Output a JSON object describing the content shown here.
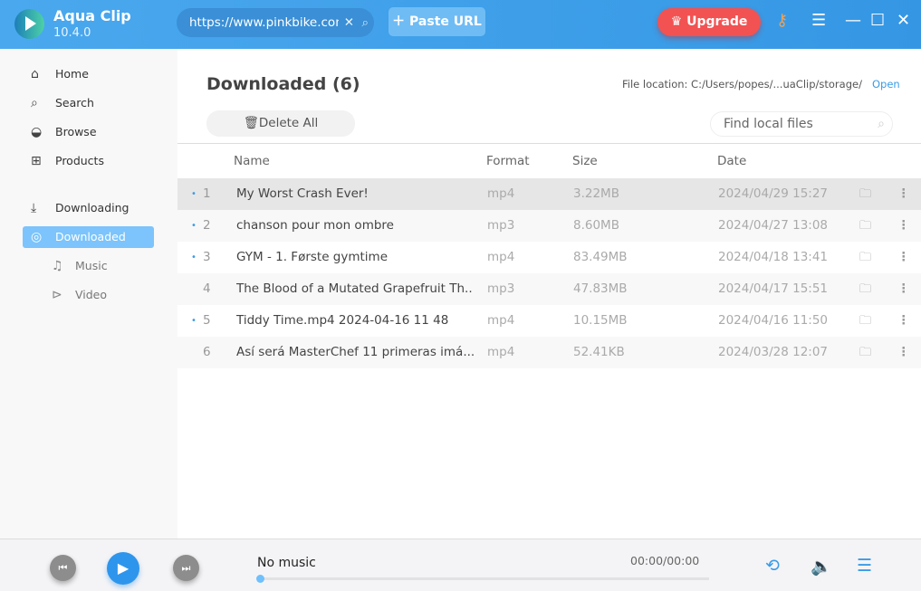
{
  "app": {
    "name": "Aqua Clip",
    "version": "10.4.0"
  },
  "header": {
    "url_value": "https://www.pinkbike.com",
    "paste_label": "Paste URL",
    "upgrade_label": "Upgrade"
  },
  "sidebar": {
    "items": [
      {
        "label": "Home",
        "icon": "home-icon"
      },
      {
        "label": "Search",
        "icon": "search-icon"
      },
      {
        "label": "Browse",
        "icon": "globe-icon"
      },
      {
        "label": "Products",
        "icon": "grid-icon"
      },
      {
        "label": "Downloading",
        "icon": "download-icon"
      },
      {
        "label": "Downloaded",
        "icon": "check-circle-icon"
      },
      {
        "label": "Music",
        "icon": "music-icon"
      },
      {
        "label": "Video",
        "icon": "play-circle-icon"
      }
    ]
  },
  "main": {
    "title": "Downloaded (6)",
    "file_location": "File location: C:/Users/popes/...uaClip/storage/",
    "open_label": "Open",
    "delete_all_label": "Delete All",
    "find_placeholder": "Find local files",
    "columns": {
      "name": "Name",
      "format": "Format",
      "size": "Size",
      "date": "Date"
    },
    "rows": [
      {
        "n": "1",
        "dot": "•",
        "name": "My Worst Crash Ever!",
        "format": "mp4",
        "size": "3.22MB",
        "date": "2024/04/29 15:27"
      },
      {
        "n": "2",
        "dot": "•",
        "name": "chanson pour mon ombre",
        "format": "mp3",
        "size": "8.60MB",
        "date": "2024/04/27 13:08"
      },
      {
        "n": "3",
        "dot": "•",
        "name": "GYM - 1. Første gymtime",
        "format": "mp4",
        "size": "83.49MB",
        "date": "2024/04/18 13:41"
      },
      {
        "n": "4",
        "dot": "",
        "name": "The Blood of a Mutated Grapefruit   Th..",
        "format": "mp3",
        "size": "47.83MB",
        "date": "2024/04/17 15:51"
      },
      {
        "n": "5",
        "dot": "•",
        "name": "Tiddy Time.mp4 2024-04-16 11 48",
        "format": "mp4",
        "size": "10.15MB",
        "date": "2024/04/16 11:50"
      },
      {
        "n": "6",
        "dot": "",
        "name": "Así será MasterChef 11  primeras imá...",
        "format": "mp4",
        "size": "52.41KB",
        "date": "2024/03/28 12:07"
      }
    ]
  },
  "player": {
    "title": "No music",
    "time": "00:00/00:00",
    "progress": 0
  },
  "colors": {
    "accent": "#3a9be6",
    "header": "#4aa8ee",
    "upgrade": "#f25252",
    "selected_nav": "#7cc4fb"
  }
}
